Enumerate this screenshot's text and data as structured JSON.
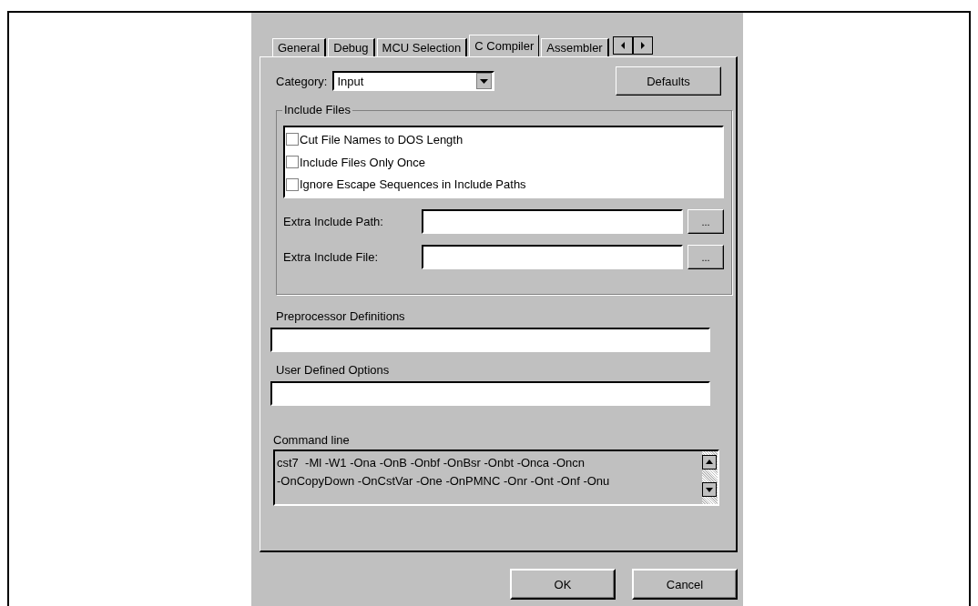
{
  "tabs": [
    {
      "label": "General",
      "selected": false
    },
    {
      "label": "Debug",
      "selected": false
    },
    {
      "label": "MCU Selection",
      "selected": false
    },
    {
      "label": "C Compiler",
      "selected": true
    },
    {
      "label": "Assembler",
      "selected": false
    }
  ],
  "category": {
    "label": "Category:",
    "value": "Input"
  },
  "defaults_button": "Defaults",
  "include_files": {
    "title": "Include Files",
    "options": [
      {
        "label": "Cut File Names to DOS Length",
        "checked": false
      },
      {
        "label": "Include Files Only Once",
        "checked": false
      },
      {
        "label": "Ignore Escape Sequences in Include Paths",
        "checked": false
      }
    ],
    "fields": [
      {
        "label": "Extra Include Path:",
        "browse": "..."
      },
      {
        "label": "Extra Include File:",
        "browse": "..."
      }
    ]
  },
  "preprocessor": {
    "label": "Preprocessor Definitions"
  },
  "user_options": {
    "label": "User Defined Options"
  },
  "command_line": {
    "label": "Command line",
    "lines": [
      "cst7  -Ml -W1 -Ona -OnB -Onbf -OnBsr -Onbt -Onca -Oncn",
      "-OnCopyDown -OnCstVar -One -OnPMNC -Onr -Ont -Onf -Onu"
    ]
  },
  "buttons": [
    "OK",
    "Cancel"
  ]
}
